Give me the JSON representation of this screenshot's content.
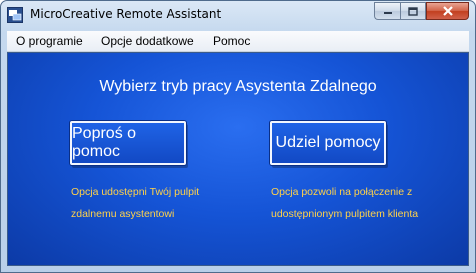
{
  "window": {
    "title": "MicroCreative Remote Assistant"
  },
  "menu": {
    "items": [
      "O programie",
      "Opcje dodatkowe",
      "Pomoc"
    ]
  },
  "main": {
    "heading": "Wybierz tryb pracy Asystenta Zdalnego",
    "request_help": {
      "label": "Poproś o pomoc",
      "desc_line1": "Opcja udostępni Twój pulpit",
      "desc_line2": "zdalnemu asystentowi"
    },
    "give_help": {
      "label": "Udziel pomocy",
      "desc_line1": "Opcja pozwoli na połączenie z",
      "desc_line2": "udostępnionym pulpitem klienta"
    }
  },
  "colors": {
    "background": "#1554d6",
    "description_text": "#ffd24a",
    "button_border": "#f2f6ff"
  }
}
